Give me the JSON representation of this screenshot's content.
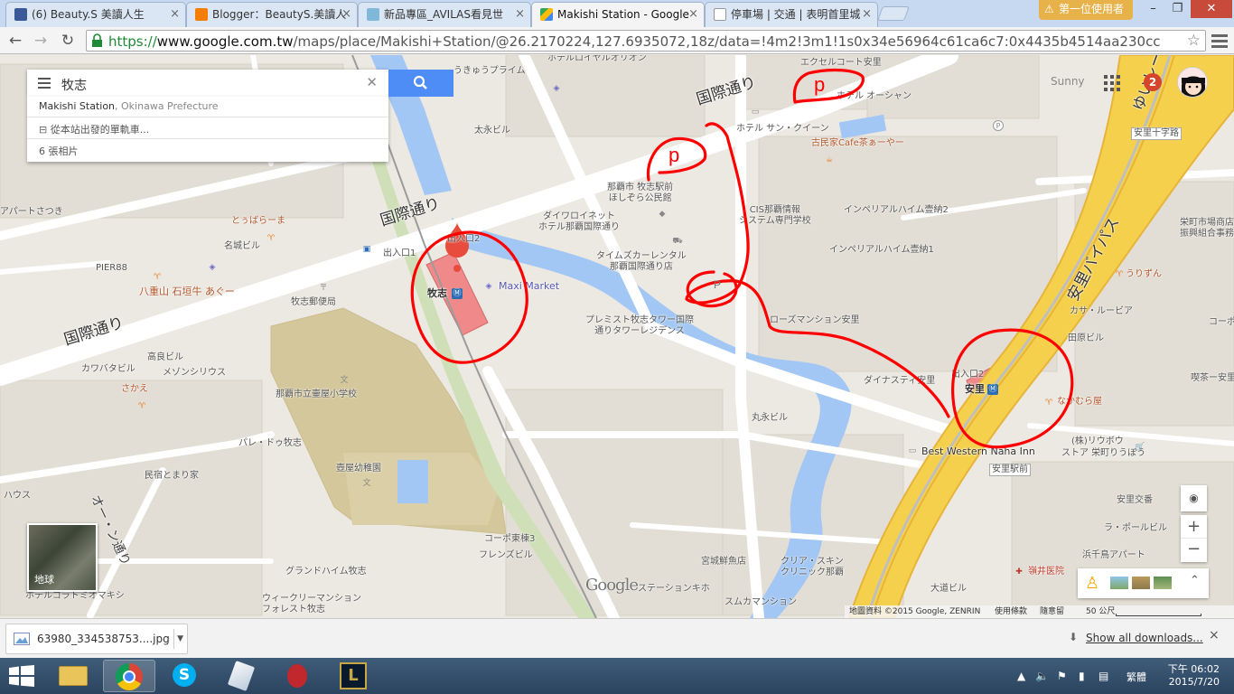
{
  "browser": {
    "tabs": [
      {
        "label": "(6) Beauty.S 美讀人生",
        "icon": "facebook-icon"
      },
      {
        "label": "Blogger：BeautyS.美讀人",
        "icon": "blogger-icon"
      },
      {
        "label": "新品專區_AVILAS看見世",
        "icon": "avilas-icon"
      },
      {
        "label": "Makishi Station - Google",
        "icon": "google-maps-icon"
      },
      {
        "label": "停車場 | 交通 | 表明首里城",
        "icon": "page-icon"
      }
    ],
    "user_badge": "第一位使用者",
    "url_scheme": "https://",
    "url_host": "www.google.com.tw",
    "url_path": "/maps/place/Makishi+Station/@26.2170224,127.6935072,18z/data=!4m2!3m1!1s0x34e56964c61ca6c7:0x4435b4514aa230cc"
  },
  "map": {
    "search": {
      "value": "牧志"
    },
    "panel": {
      "place": "Makishi Station",
      "place_region": ", Okinawa Prefecture",
      "route_link": "從本站出發的單軌車...",
      "photos": "6 張相片"
    },
    "sunny": "Sunny",
    "notification_count": "2",
    "earth_label": "地球",
    "google_logo": "Google",
    "attribution": {
      "data": "地圖資料 ©2015 Google, ZENRIN",
      "terms": "使用條款",
      "feedback": "隨意留",
      "scale": "50 公尺"
    },
    "labels": {
      "kokusai1": "国際通り",
      "kokusai2": "国際通り",
      "kokusai3": "国際通り",
      "kokusai4": "国際通り",
      "yui_rail": "ゆいレール",
      "asato_bypass": "安里バイパス",
      "ozanne": "オー・ン通り",
      "asato_crossing": "安里十字路",
      "makishi_station": "牧志",
      "asato_station": "安里",
      "exit2a": "出入口2",
      "exit1": "出入口1",
      "exit2b": "出入口2",
      "exit1b": "出入口1",
      "maxi_market": "Maxi Market",
      "makishi_post": "牧志郵便局",
      "school": "那覇市立壷屋小学校",
      "kindergarten": "壺屋幼稚園",
      "hostel_makishi": "那覇市 牧志駅前\nほしぞら公民館",
      "daiwa": "ダイワロイネット\nホテル那覇国際通り",
      "times_car": "タイムズカーレンタル\n那覇国際通り店",
      "premist": "プレミスト牧志タワー国際\n通りタワーレジデンス",
      "cis": "CIS那覇情報\nシステム専門学校",
      "imperial2": "インペリアルハイム壹納2",
      "imperial1": "インペリアルハイム壹納1",
      "hotel_sun": "ホテル サン・クイーン",
      "kominka": "古民家Cafe茶ぁーやー",
      "hotel_ocean": "ホテル オーシャン",
      "excel": "エクセルコート安里",
      "hotel_royal": "ホテルロイヤルオリオン",
      "uki": "うきゅうプライム",
      "taiei": "太永ビル",
      "apart_satsuki": "アパートさつき",
      "touhara": "とぅばらーま",
      "meiji": "名城ビル",
      "pier88": "PIER88",
      "yaeyama": "八重山 石垣牛 あぐー",
      "takatomo": "高良ビル",
      "kawabata": "カワバタビル",
      "maison": "メゾンシリウス",
      "sakae": "さかえ",
      "pale": "パレ・ドゥ牧志",
      "minshuku": "民宿とまり家",
      "haus": "ハウス",
      "hotel_comfort": "ホテルコラトミオマキシ",
      "grand_heim": "グランドハイム牧志",
      "weekly": "ウィークリーマンション\nフォレスト牧志",
      "coop": "コーポ東棟3",
      "friends": "フレンズビル",
      "marue": "丸永ビル",
      "dinasty": "ダイナスティ安里",
      "best_western": "Best Western Naha Inn",
      "asato_ekimae": "安里駅前",
      "star_house": "ストア 栄町りうぼう",
      "ryubo": "(株)リウボウ",
      "nakamuraya": "なかむら屋",
      "tamaribi": "田原ビル",
      "casa": "カサ・ルービア",
      "urizun": "うりずん",
      "sakaemachi": "栄町市場商店\n振興組合事務所",
      "co_ra": "コーポ",
      "kyoto": "喫茶ー安里",
      "asato_kosa": "安里交番",
      "ra_pole": "ラ・ポールビル",
      "hamachidori": "浜千鳥アパート",
      "fukui": "嶺井医院",
      "okawa": "大道ビル",
      "suka": "スムカマンション",
      "miyagi": "宮城鮮魚店",
      "clear": "クリア・スキン\nクリニック那覇",
      "station_kiho": "ステーションキホ",
      "rose": "ローズマンション安里",
      "sakaemachi2": "栄町"
    }
  },
  "download": {
    "file": "63980_334538753....jpg",
    "show_all": "Show all downloads...",
    "close": "×"
  },
  "taskbar": {
    "lang": "繁體",
    "time": "下午 06:02",
    "date": "2015/7/20"
  },
  "colors": {
    "water": "#a3c7f4",
    "highway": "#f5d04d",
    "highway_edge": "#e7b43a",
    "annotation": "#ff0000",
    "station_fill": "#f08a8a",
    "map_bg": "#ece9e2"
  }
}
